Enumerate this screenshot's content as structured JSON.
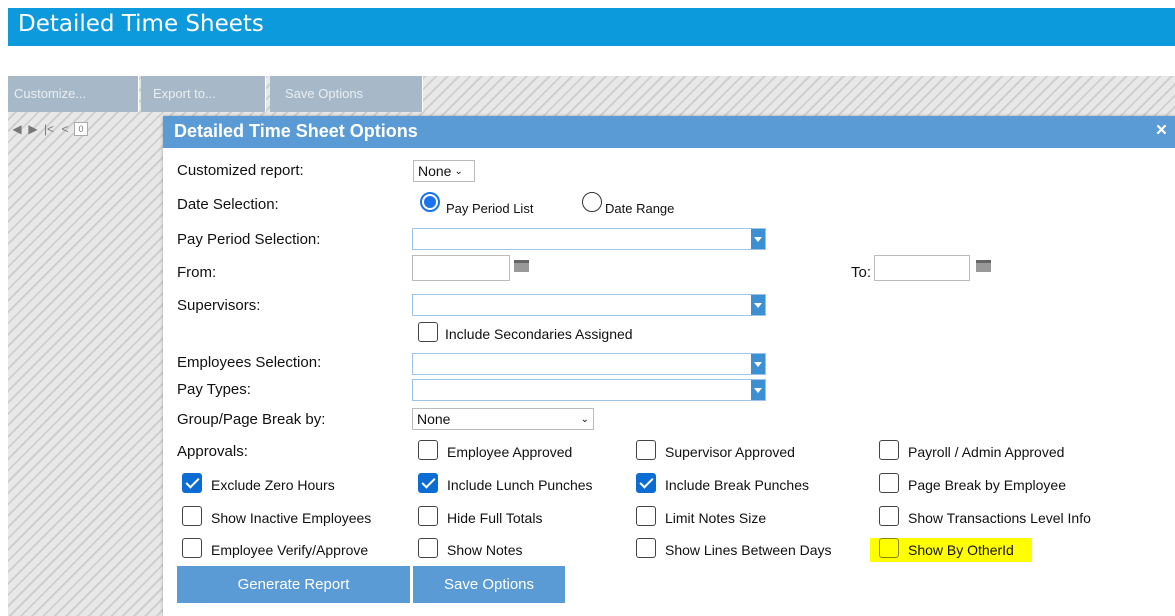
{
  "page_title": "Detailed Time Sheets",
  "toolbar": {
    "customize": "Customize...",
    "export": "Export to...",
    "save": "Save Options"
  },
  "nav": {
    "page": "0"
  },
  "dialog": {
    "title": "Detailed Time Sheet Options",
    "close": "×",
    "customized_report": {
      "label": "Customized report:",
      "value": "None"
    },
    "date_selection": {
      "label": "Date Selection:",
      "option_pay_period": "Pay Period List",
      "option_date_range": "Date Range",
      "selected": "pay_period"
    },
    "pay_period_selection": {
      "label": "Pay Period Selection:"
    },
    "from": {
      "label": "From:"
    },
    "to": {
      "label": "To:"
    },
    "supervisors": {
      "label": "Supervisors:"
    },
    "include_secondaries": {
      "label": "Include Secondaries Assigned",
      "checked": false
    },
    "employees_selection": {
      "label": "Employees Selection:"
    },
    "pay_types": {
      "label": "Pay Types:"
    },
    "group_break": {
      "label": "Group/Page Break by:",
      "value": "None"
    },
    "approvals": {
      "label": "Approvals:"
    },
    "checkboxes": {
      "employee_approved": {
        "label": "Employee Approved",
        "checked": false
      },
      "supervisor_approved": {
        "label": "Supervisor Approved",
        "checked": false
      },
      "payroll_approved": {
        "label": "Payroll / Admin Approved",
        "checked": false
      },
      "exclude_zero": {
        "label": "Exclude Zero Hours",
        "checked": true
      },
      "include_lunch": {
        "label": "Include Lunch Punches",
        "checked": true
      },
      "include_break": {
        "label": "Include Break Punches",
        "checked": true
      },
      "page_break_employee": {
        "label": "Page Break by Employee",
        "checked": false
      },
      "show_inactive": {
        "label": "Show Inactive Employees",
        "checked": false
      },
      "hide_full_totals": {
        "label": "Hide Full Totals",
        "checked": false
      },
      "limit_notes": {
        "label": "Limit Notes Size",
        "checked": false
      },
      "show_transactions": {
        "label": "Show Transactions Level Info",
        "checked": false
      },
      "employee_verify": {
        "label": "Employee Verify/Approve",
        "checked": false
      },
      "show_notes": {
        "label": "Show Notes",
        "checked": false
      },
      "show_lines": {
        "label": "Show Lines Between Days",
        "checked": false
      },
      "show_by_otherid": {
        "label": "Show By OtherId",
        "checked": false
      }
    },
    "generate_button": "Generate Report",
    "save_button": "Save Options"
  },
  "colors": {
    "header": "#0d9add",
    "dialog_title": "#5b9bd5",
    "highlight": "#ffff00",
    "checkbox_on": "#0b6cd4"
  }
}
